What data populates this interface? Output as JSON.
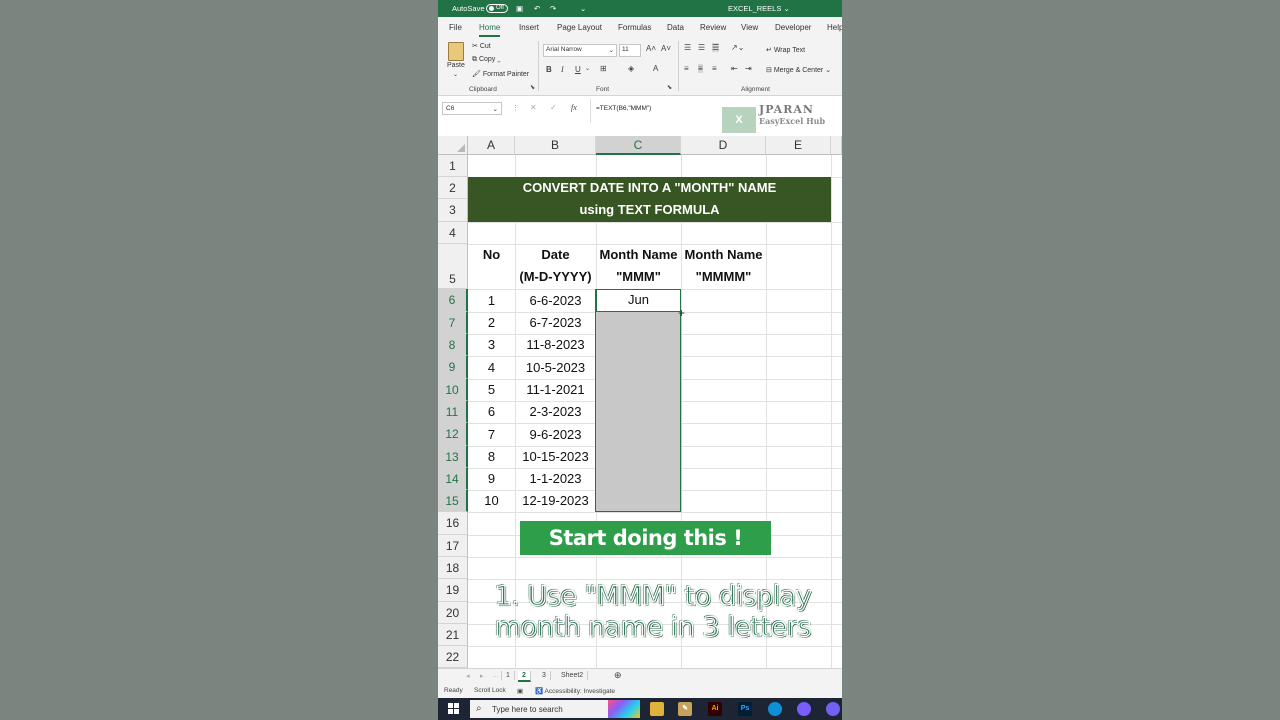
{
  "titlebar": {
    "autosave": "AutoSave",
    "toggle": "Off",
    "filename": "EXCEL_REELS",
    "chevron": "⌄"
  },
  "ribbon_tabs": [
    "File",
    "Home",
    "Insert",
    "Page Layout",
    "Formulas",
    "Data",
    "Review",
    "View",
    "Developer",
    "Help"
  ],
  "ribbon": {
    "paste": "Paste",
    "cut": "Cut",
    "copy": "Copy",
    "format_painter": "Format Painter",
    "clipboard": "Clipboard",
    "font_name": "Arial Narrow",
    "font_size": "11",
    "font": "Font",
    "wrap_text": "Wrap Text",
    "merge_center": "Merge & Center",
    "alignment": "Alignment",
    "bold": "B",
    "italic": "I",
    "underline": "U"
  },
  "formula_bar": {
    "name_box": "C6",
    "formula": "=TEXT(B6,\"MMM\")",
    "fx": "fx"
  },
  "watermark": {
    "line1": "JPARAN",
    "line2": "EasyExcel Hub",
    "x": "X"
  },
  "columns": [
    "A",
    "B",
    "C",
    "D",
    "E"
  ],
  "rows": [
    "1",
    "2",
    "3",
    "4",
    "5",
    "6",
    "7",
    "8",
    "9",
    "10",
    "11",
    "12",
    "13",
    "14",
    "15",
    "16",
    "17",
    "18",
    "19",
    "20",
    "21",
    "22"
  ],
  "banner": {
    "line1": "CONVERT DATE INTO A \"MONTH\" NAME",
    "line2": "using TEXT FORMULA"
  },
  "table": {
    "headers": {
      "no": "No",
      "date1": "Date",
      "date2": "(M-D-YYYY)",
      "m1a": "Month Name",
      "m1b": "\"MMM\"",
      "m2a": "Month Name",
      "m2b": "\"MMMM\""
    },
    "rows": [
      {
        "no": "1",
        "date": "6-6-2023",
        "mmm": "Jun"
      },
      {
        "no": "2",
        "date": "6-7-2023"
      },
      {
        "no": "3",
        "date": "11-8-2023"
      },
      {
        "no": "4",
        "date": "10-5-2023"
      },
      {
        "no": "5",
        "date": "11-1-2021"
      },
      {
        "no": "6",
        "date": "2-3-2023"
      },
      {
        "no": "7",
        "date": "9-6-2023"
      },
      {
        "no": "8",
        "date": "10-15-2023"
      },
      {
        "no": "9",
        "date": "1-1-2023"
      },
      {
        "no": "10",
        "date": "12-19-2023"
      }
    ]
  },
  "cta": "Start doing this !",
  "caption": {
    "line1": "1. Use \"MMM\" to display",
    "line2": "month  name in 3 letters"
  },
  "sheet_tabs": {
    "tabs": [
      "1",
      "2",
      "3",
      "Sheet2"
    ],
    "active": "2"
  },
  "status": {
    "ready": "Ready",
    "scroll_lock": "Scroll Lock",
    "accessibility": "Accessibility: Investigate"
  },
  "taskbar": {
    "search_placeholder": "Type here to search",
    "ai": "Ai",
    "ps": "Ps"
  },
  "colors": {
    "excel_green": "#217346",
    "banner_green": "#375623",
    "cta_green": "#2f9e4b"
  }
}
